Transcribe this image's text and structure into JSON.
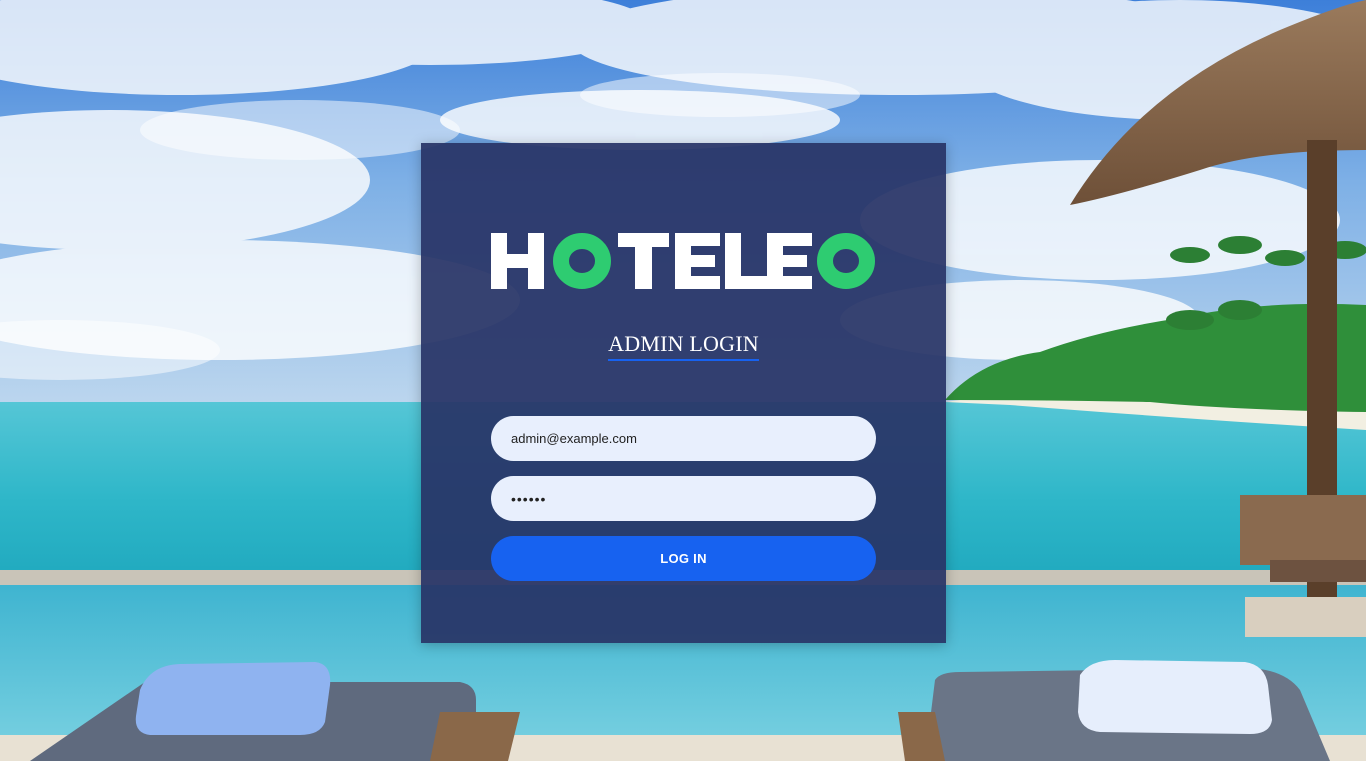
{
  "colors": {
    "card_background": "#283466",
    "accent_blue": "#1762f0",
    "logo_white": "#ffffff",
    "logo_green": "#2ecc71",
    "input_background": "#e8effd"
  },
  "logo": {
    "text": "HOTELEO",
    "letters": [
      "H",
      "O",
      "T",
      "E",
      "L",
      "E",
      "O"
    ]
  },
  "login": {
    "title": "ADMIN LOGIN",
    "email_value": "admin@example.com",
    "password_value": "••••••",
    "submit_label": "LOG IN"
  }
}
